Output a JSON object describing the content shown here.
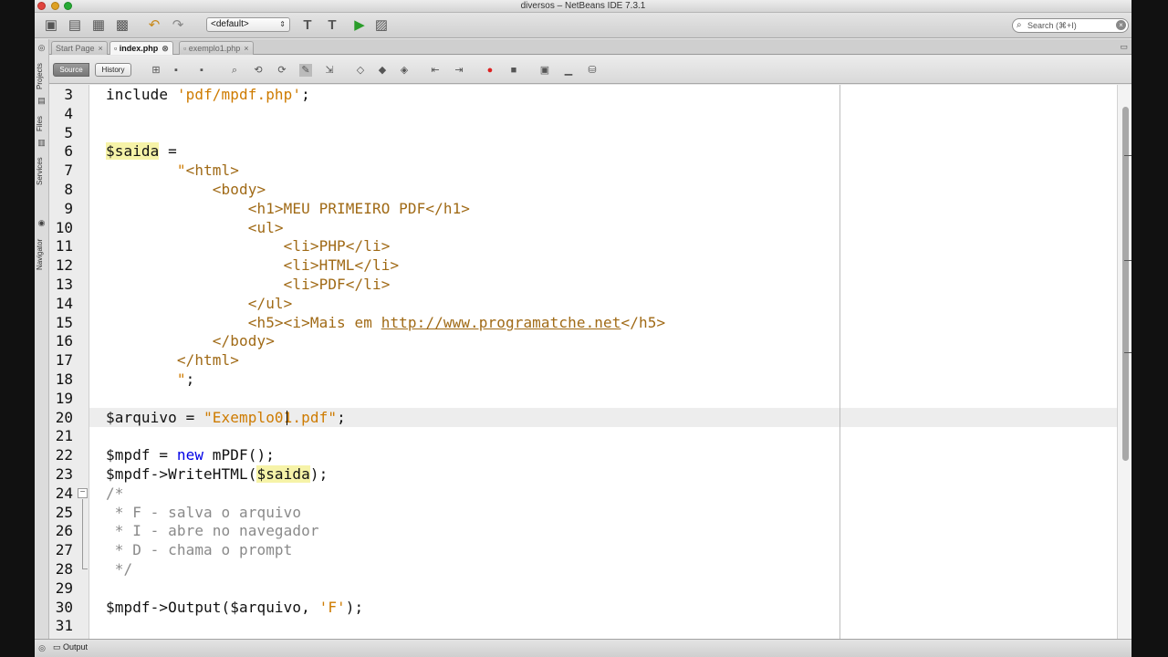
{
  "window": {
    "title": "diversos – NetBeans IDE 7.3.1"
  },
  "toolbar": {
    "config_selected": "<default>",
    "search_placeholder": "Search (⌘+I)",
    "icons": [
      "new-file-icon",
      "new-project-icon",
      "open-project-icon",
      "save-all-icon",
      "undo-icon",
      "redo-icon",
      "clean-build-icon",
      "build-icon",
      "run-icon",
      "debug-icon"
    ]
  },
  "side_panel": {
    "labels": [
      "Projects",
      "Files",
      "Services",
      "Navigator"
    ]
  },
  "tabs": [
    {
      "label": "Start Page",
      "active": false
    },
    {
      "label": "index.php",
      "active": true
    },
    {
      "label": "exemplo1.php",
      "active": false
    }
  ],
  "editor_toolbar": {
    "source_label": "Source",
    "history_label": "History"
  },
  "editor": {
    "current_line": 20,
    "lines": [
      {
        "n": "3",
        "tokens": [
          {
            "t": "include ",
            "c": ""
          },
          {
            "t": "'pdf/mpdf.php'",
            "c": "str"
          },
          {
            "t": ";",
            "c": ""
          }
        ]
      },
      {
        "n": "4",
        "tokens": []
      },
      {
        "n": "5",
        "tokens": []
      },
      {
        "n": "6",
        "tokens": [
          {
            "t": "$",
            "c": "hl"
          },
          {
            "t": "saida",
            "c": "hl"
          },
          {
            "t": " =",
            "c": ""
          }
        ]
      },
      {
        "n": "7",
        "tokens": [
          {
            "t": "        \"",
            "c": "str"
          },
          {
            "t": "<html>",
            "c": "str-body"
          }
        ]
      },
      {
        "n": "8",
        "tokens": [
          {
            "t": "            <body>",
            "c": "str-body"
          }
        ]
      },
      {
        "n": "9",
        "tokens": [
          {
            "t": "                <h1>MEU PRIMEIRO PDF</h1>",
            "c": "str-body"
          }
        ]
      },
      {
        "n": "10",
        "tokens": [
          {
            "t": "                <ul>",
            "c": "str-body"
          }
        ]
      },
      {
        "n": "11",
        "tokens": [
          {
            "t": "                    <li>PHP</li>",
            "c": "str-body"
          }
        ]
      },
      {
        "n": "12",
        "tokens": [
          {
            "t": "                    <li>HTML</li>",
            "c": "str-body"
          }
        ]
      },
      {
        "n": "13",
        "tokens": [
          {
            "t": "                    <li>PDF</li>",
            "c": "str-body"
          }
        ]
      },
      {
        "n": "14",
        "tokens": [
          {
            "t": "                </ul>",
            "c": "str-body"
          }
        ]
      },
      {
        "n": "15",
        "tokens": [
          {
            "t": "                <h5><i>Mais em ",
            "c": "str-body"
          },
          {
            "t": "http://www.programatche.net",
            "c": "str-body link"
          },
          {
            "t": "</h5>",
            "c": "str-body"
          }
        ]
      },
      {
        "n": "16",
        "tokens": [
          {
            "t": "            </body>",
            "c": "str-body"
          }
        ]
      },
      {
        "n": "17",
        "tokens": [
          {
            "t": "        </html>",
            "c": "str-body"
          }
        ]
      },
      {
        "n": "18",
        "tokens": [
          {
            "t": "        \"",
            "c": "str"
          },
          {
            "t": ";",
            "c": ""
          }
        ]
      },
      {
        "n": "19",
        "tokens": []
      },
      {
        "n": "20",
        "tokens": [
          {
            "t": "$arquivo = ",
            "c": ""
          },
          {
            "t": "\"Exemplo01.pdf\"",
            "c": "str"
          },
          {
            "t": ";",
            "c": ""
          }
        ]
      },
      {
        "n": "21",
        "tokens": []
      },
      {
        "n": "22",
        "tokens": [
          {
            "t": "$mpdf = ",
            "c": ""
          },
          {
            "t": "new",
            "c": "kw"
          },
          {
            "t": " mPDF();",
            "c": ""
          }
        ]
      },
      {
        "n": "23",
        "tokens": [
          {
            "t": "$mpdf->WriteHTML(",
            "c": ""
          },
          {
            "t": "$saida",
            "c": "hl"
          },
          {
            "t": ");",
            "c": ""
          }
        ]
      },
      {
        "n": "24",
        "tokens": [
          {
            "t": "/*",
            "c": "cmt"
          }
        ]
      },
      {
        "n": "25",
        "tokens": [
          {
            "t": " * F - salva o arquivo",
            "c": "cmt"
          }
        ]
      },
      {
        "n": "26",
        "tokens": [
          {
            "t": " * I - abre no navegador",
            "c": "cmt"
          }
        ]
      },
      {
        "n": "27",
        "tokens": [
          {
            "t": " * D - chama o prompt",
            "c": "cmt"
          }
        ]
      },
      {
        "n": "28",
        "tokens": [
          {
            "t": " */",
            "c": "cmt"
          }
        ]
      },
      {
        "n": "29",
        "tokens": []
      },
      {
        "n": "30",
        "tokens": [
          {
            "t": "$mpdf->Output($arquivo, ",
            "c": ""
          },
          {
            "t": "'F'",
            "c": "str"
          },
          {
            "t": ");",
            "c": ""
          }
        ]
      },
      {
        "n": "31",
        "tokens": []
      }
    ]
  },
  "statusbar": {
    "output_label": "Output"
  }
}
